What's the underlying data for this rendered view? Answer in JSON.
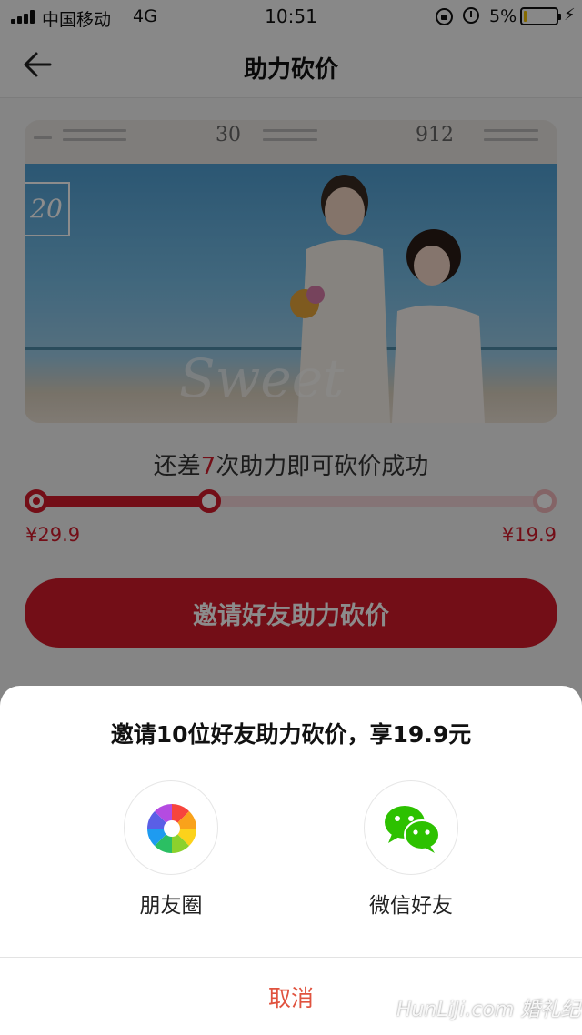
{
  "status_bar": {
    "carrier": "中国移动",
    "network": "4G",
    "time": "10:51",
    "battery_percent_label": "5%",
    "battery_level": 0.05
  },
  "header": {
    "title": "助力砍价",
    "back_icon": "arrow-left-icon"
  },
  "banner": {
    "emblem_text": "20",
    "script_text": "Sweet",
    "strip_marks": [
      "30",
      "912"
    ]
  },
  "bargain": {
    "remaining_prefix": "还差",
    "remaining_count": "7",
    "remaining_suffix": "次助力即可砍价成功",
    "progress": 0.34,
    "start_price": "¥29.9",
    "target_price": "¥19.9",
    "button_label": "邀请好友助力砍价"
  },
  "share_sheet": {
    "title": "邀请10位好友助力砍价，享19.9元",
    "options": [
      {
        "label": "朋友圈",
        "icon": "moments-aperture-icon"
      },
      {
        "label": "微信好友",
        "icon": "wechat-icon"
      }
    ],
    "cancel_label": "取消"
  },
  "watermark": "HunLiJi.com 婚礼纪",
  "colors": {
    "accent": "#d21b2a",
    "cancel": "#e0533f",
    "wechat_green": "#2dc100"
  }
}
